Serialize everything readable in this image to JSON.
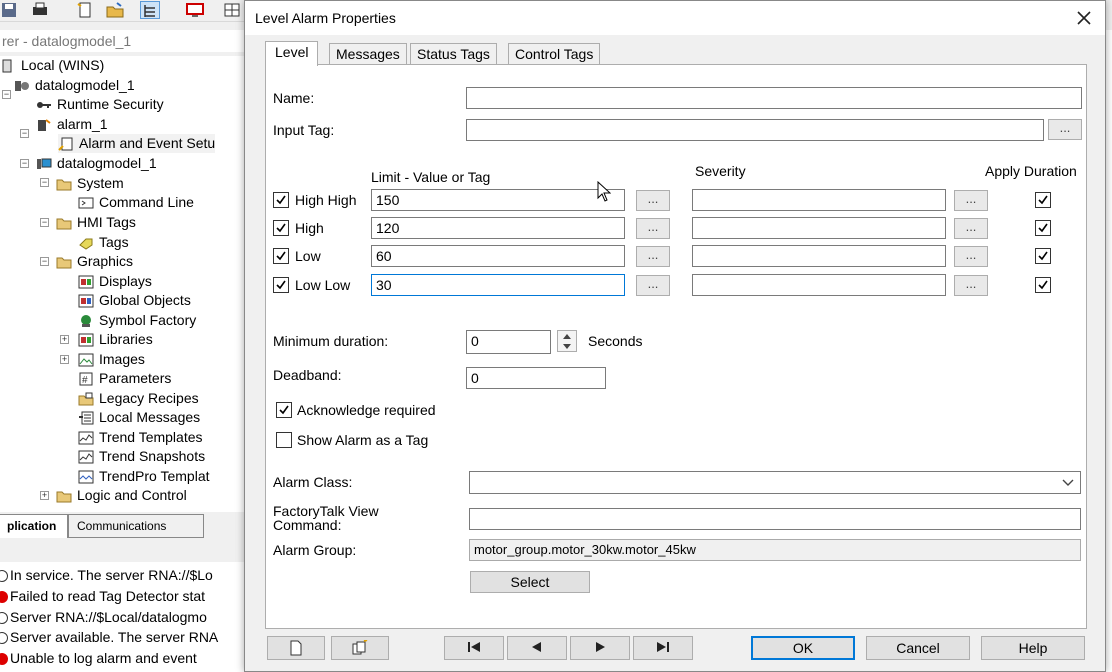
{
  "explorer": {
    "title": "rer - datalogmodel_1",
    "tree": [
      {
        "label": "Local (WINS)",
        "icon": "server-icon"
      },
      {
        "label": "datalogmodel_1",
        "icon": "application-icon"
      },
      {
        "label": "Runtime Security",
        "icon": "key-icon"
      },
      {
        "label": "alarm_1",
        "icon": "alarm-server-icon"
      },
      {
        "label": "Alarm and Event Setu",
        "icon": "alarm-setup-icon"
      },
      {
        "label": "datalogmodel_1",
        "icon": "hmi-server-icon"
      },
      {
        "label": "System",
        "icon": "folder-icon"
      },
      {
        "label": "Command Line",
        "icon": "command-line-icon"
      },
      {
        "label": "HMI Tags",
        "icon": "folder-icon"
      },
      {
        "label": "Tags",
        "icon": "tag-icon"
      },
      {
        "label": "Graphics",
        "icon": "folder-icon"
      },
      {
        "label": "Displays",
        "icon": "display-icon"
      },
      {
        "label": "Global Objects",
        "icon": "global-objects-icon"
      },
      {
        "label": "Symbol Factory",
        "icon": "symbol-factory-icon"
      },
      {
        "label": "Libraries",
        "icon": "library-icon"
      },
      {
        "label": "Images",
        "icon": "image-icon"
      },
      {
        "label": "Parameters",
        "icon": "parameters-icon"
      },
      {
        "label": "Legacy Recipes",
        "icon": "recipe-icon"
      },
      {
        "label": "Local Messages",
        "icon": "messages-icon"
      },
      {
        "label": "Trend Templates",
        "icon": "trend-icon"
      },
      {
        "label": "Trend Snapshots",
        "icon": "trend-icon"
      },
      {
        "label": "TrendPro Templat",
        "icon": "trendpro-icon"
      },
      {
        "label": "Logic and Control",
        "icon": "folder-icon"
      }
    ],
    "bottom_tabs": [
      "plication",
      "Communications"
    ],
    "log": [
      {
        "text": "In service. The server RNA://$Lo",
        "status": "info"
      },
      {
        "text": "Failed to read Tag Detector stat",
        "status": "error"
      },
      {
        "text": "Server RNA://$Local/datalogmo",
        "status": "info"
      },
      {
        "text": "Server available. The server RNA",
        "status": "info"
      },
      {
        "text": "Unable to log alarm and event",
        "status": "error"
      }
    ]
  },
  "dialog": {
    "title": "Level Alarm Properties",
    "tabs": [
      "Level",
      "Messages",
      "Status Tags",
      "Control Tags"
    ],
    "name_label": "Name:",
    "name_value": "",
    "input_tag_label": "Input Tag:",
    "input_tag_value": "",
    "ellipsis": "...",
    "limit_header": "Limit - Value or Tag",
    "severity_header": "Severity",
    "apply_duration_header": "Apply Duration",
    "levels": [
      {
        "label": "High High",
        "value": "150",
        "checked": true,
        "apply": true
      },
      {
        "label": "High",
        "value": "120",
        "checked": true,
        "apply": true
      },
      {
        "label": "Low",
        "value": "60",
        "checked": true,
        "apply": true
      },
      {
        "label": "Low Low",
        "value": "30",
        "checked": true,
        "apply": true
      }
    ],
    "min_duration_label": "Minimum duration:",
    "min_duration_value": "0",
    "seconds_label": "Seconds",
    "deadband_label": "Deadband:",
    "deadband_value": "0",
    "ack_label": "Acknowledge required",
    "show_tag_label": "Show Alarm as a Tag",
    "alarm_class_label": "Alarm Class:",
    "ftv_command_label_1": "FactoryTalk View",
    "ftv_command_label_2": "Command:",
    "alarm_group_label": "Alarm Group:",
    "alarm_group_value": "motor_group.motor_30kw.motor_45kw",
    "select_label": "Select",
    "ok_label": "OK",
    "cancel_label": "Cancel",
    "help_label": "Help"
  }
}
